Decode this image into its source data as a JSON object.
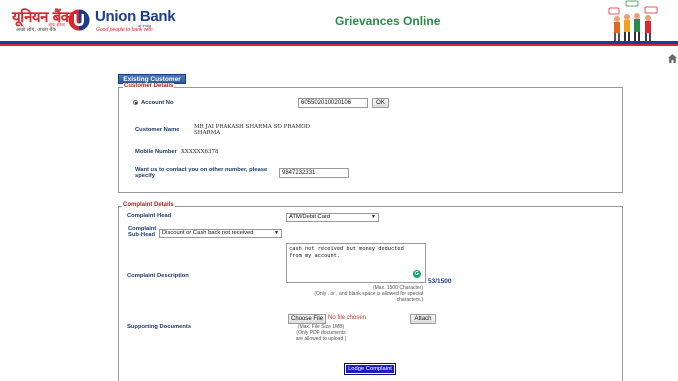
{
  "header": {
    "logo_hindi": "यूनियन बैंक",
    "logo_hindi_sub": "ऑफ इंडिया",
    "logo_tagline_hindi": "अच्छे लोग, अच्छा बैंक",
    "logo_english": "Union Bank",
    "logo_english_sub": "of India",
    "logo_tagline_english": "Good people to bank with",
    "title": "Grievances Online"
  },
  "tab": {
    "label": "Existing Customer"
  },
  "customer_details": {
    "legend": "Customer Details",
    "account_label": "Account No",
    "account_value": "605502010020106",
    "ok_label": "OK",
    "name_label": "Customer Name",
    "name_value_line1": "MR JAI PRAKASH SHARMA SO PRAMOD",
    "name_value_line2": "SHARMA",
    "mobile_label": "Mobile Number",
    "mobile_value": "XXXXXX6378",
    "alt_contact_label_line1": "Want us to contact you on other number, please",
    "alt_contact_label_line2": "specify",
    "alt_contact_value": "9847232331"
  },
  "complaint_details": {
    "legend": "Complaint Details",
    "head_label": "Complaint Head",
    "head_value": "ATM/Debit Card",
    "subhead_label_line1": "Complaint",
    "subhead_label_line2": "Sub-Head",
    "subhead_value": "Discount or Cash back not received",
    "description_label": "Complaint Description",
    "description_value": "cash not received but money deducted\nfrom my account.",
    "counter": "53/1500",
    "desc_hint_line1": "(Max. 1500 Character)",
    "desc_hint_line2": "(Only . or , and blank space is allowed for special",
    "desc_hint_line3": "characters.)",
    "docs_label": "Supporting Documents",
    "choose_file_label": "Choose File",
    "no_file_label": "No file chosen",
    "attach_label": "Attach",
    "file_hint_line1": "(Max. File Size 1MB)",
    "file_hint_line2": "(Only PDF documents",
    "file_hint_line3": "are allowed to upload.)",
    "lodge_label": "Lodge Complaint"
  },
  "colors": {
    "brand_blue": "#1a3e8c",
    "brand_red": "#d7262f",
    "title_green": "#2a8a4a",
    "legend_red": "#b22222",
    "lodge_button": "#1d1dc8"
  }
}
